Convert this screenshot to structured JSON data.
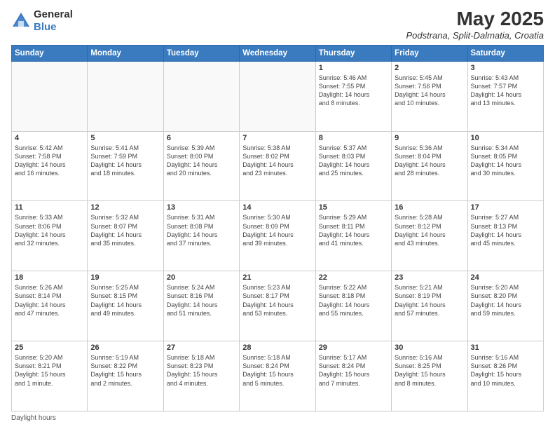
{
  "logo": {
    "general": "General",
    "blue": "Blue"
  },
  "title": "May 2025",
  "subtitle": "Podstrana, Split-Dalmatia, Croatia",
  "days_of_week": [
    "Sunday",
    "Monday",
    "Tuesday",
    "Wednesday",
    "Thursday",
    "Friday",
    "Saturday"
  ],
  "weeks": [
    [
      {
        "day": "",
        "info": ""
      },
      {
        "day": "",
        "info": ""
      },
      {
        "day": "",
        "info": ""
      },
      {
        "day": "",
        "info": ""
      },
      {
        "day": "1",
        "info": "Sunrise: 5:46 AM\nSunset: 7:55 PM\nDaylight: 14 hours\nand 8 minutes."
      },
      {
        "day": "2",
        "info": "Sunrise: 5:45 AM\nSunset: 7:56 PM\nDaylight: 14 hours\nand 10 minutes."
      },
      {
        "day": "3",
        "info": "Sunrise: 5:43 AM\nSunset: 7:57 PM\nDaylight: 14 hours\nand 13 minutes."
      }
    ],
    [
      {
        "day": "4",
        "info": "Sunrise: 5:42 AM\nSunset: 7:58 PM\nDaylight: 14 hours\nand 16 minutes."
      },
      {
        "day": "5",
        "info": "Sunrise: 5:41 AM\nSunset: 7:59 PM\nDaylight: 14 hours\nand 18 minutes."
      },
      {
        "day": "6",
        "info": "Sunrise: 5:39 AM\nSunset: 8:00 PM\nDaylight: 14 hours\nand 20 minutes."
      },
      {
        "day": "7",
        "info": "Sunrise: 5:38 AM\nSunset: 8:02 PM\nDaylight: 14 hours\nand 23 minutes."
      },
      {
        "day": "8",
        "info": "Sunrise: 5:37 AM\nSunset: 8:03 PM\nDaylight: 14 hours\nand 25 minutes."
      },
      {
        "day": "9",
        "info": "Sunrise: 5:36 AM\nSunset: 8:04 PM\nDaylight: 14 hours\nand 28 minutes."
      },
      {
        "day": "10",
        "info": "Sunrise: 5:34 AM\nSunset: 8:05 PM\nDaylight: 14 hours\nand 30 minutes."
      }
    ],
    [
      {
        "day": "11",
        "info": "Sunrise: 5:33 AM\nSunset: 8:06 PM\nDaylight: 14 hours\nand 32 minutes."
      },
      {
        "day": "12",
        "info": "Sunrise: 5:32 AM\nSunset: 8:07 PM\nDaylight: 14 hours\nand 35 minutes."
      },
      {
        "day": "13",
        "info": "Sunrise: 5:31 AM\nSunset: 8:08 PM\nDaylight: 14 hours\nand 37 minutes."
      },
      {
        "day": "14",
        "info": "Sunrise: 5:30 AM\nSunset: 8:09 PM\nDaylight: 14 hours\nand 39 minutes."
      },
      {
        "day": "15",
        "info": "Sunrise: 5:29 AM\nSunset: 8:11 PM\nDaylight: 14 hours\nand 41 minutes."
      },
      {
        "day": "16",
        "info": "Sunrise: 5:28 AM\nSunset: 8:12 PM\nDaylight: 14 hours\nand 43 minutes."
      },
      {
        "day": "17",
        "info": "Sunrise: 5:27 AM\nSunset: 8:13 PM\nDaylight: 14 hours\nand 45 minutes."
      }
    ],
    [
      {
        "day": "18",
        "info": "Sunrise: 5:26 AM\nSunset: 8:14 PM\nDaylight: 14 hours\nand 47 minutes."
      },
      {
        "day": "19",
        "info": "Sunrise: 5:25 AM\nSunset: 8:15 PM\nDaylight: 14 hours\nand 49 minutes."
      },
      {
        "day": "20",
        "info": "Sunrise: 5:24 AM\nSunset: 8:16 PM\nDaylight: 14 hours\nand 51 minutes."
      },
      {
        "day": "21",
        "info": "Sunrise: 5:23 AM\nSunset: 8:17 PM\nDaylight: 14 hours\nand 53 minutes."
      },
      {
        "day": "22",
        "info": "Sunrise: 5:22 AM\nSunset: 8:18 PM\nDaylight: 14 hours\nand 55 minutes."
      },
      {
        "day": "23",
        "info": "Sunrise: 5:21 AM\nSunset: 8:19 PM\nDaylight: 14 hours\nand 57 minutes."
      },
      {
        "day": "24",
        "info": "Sunrise: 5:20 AM\nSunset: 8:20 PM\nDaylight: 14 hours\nand 59 minutes."
      }
    ],
    [
      {
        "day": "25",
        "info": "Sunrise: 5:20 AM\nSunset: 8:21 PM\nDaylight: 15 hours\nand 1 minute."
      },
      {
        "day": "26",
        "info": "Sunrise: 5:19 AM\nSunset: 8:22 PM\nDaylight: 15 hours\nand 2 minutes."
      },
      {
        "day": "27",
        "info": "Sunrise: 5:18 AM\nSunset: 8:23 PM\nDaylight: 15 hours\nand 4 minutes."
      },
      {
        "day": "28",
        "info": "Sunrise: 5:18 AM\nSunset: 8:24 PM\nDaylight: 15 hours\nand 5 minutes."
      },
      {
        "day": "29",
        "info": "Sunrise: 5:17 AM\nSunset: 8:24 PM\nDaylight: 15 hours\nand 7 minutes."
      },
      {
        "day": "30",
        "info": "Sunrise: 5:16 AM\nSunset: 8:25 PM\nDaylight: 15 hours\nand 8 minutes."
      },
      {
        "day": "31",
        "info": "Sunrise: 5:16 AM\nSunset: 8:26 PM\nDaylight: 15 hours\nand 10 minutes."
      }
    ]
  ],
  "footer": "Daylight hours"
}
